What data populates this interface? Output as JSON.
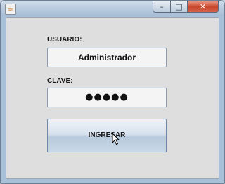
{
  "window": {
    "title_icon": "java-app-icon",
    "controls": {
      "minimize": "–",
      "maximize": "□",
      "close": "✕"
    }
  },
  "form": {
    "user_label": "USUARIO:",
    "user_value": "Administrador",
    "password_label": "CLAVE:",
    "password_value": "●●●●●",
    "submit_label": "INGRESAR"
  }
}
